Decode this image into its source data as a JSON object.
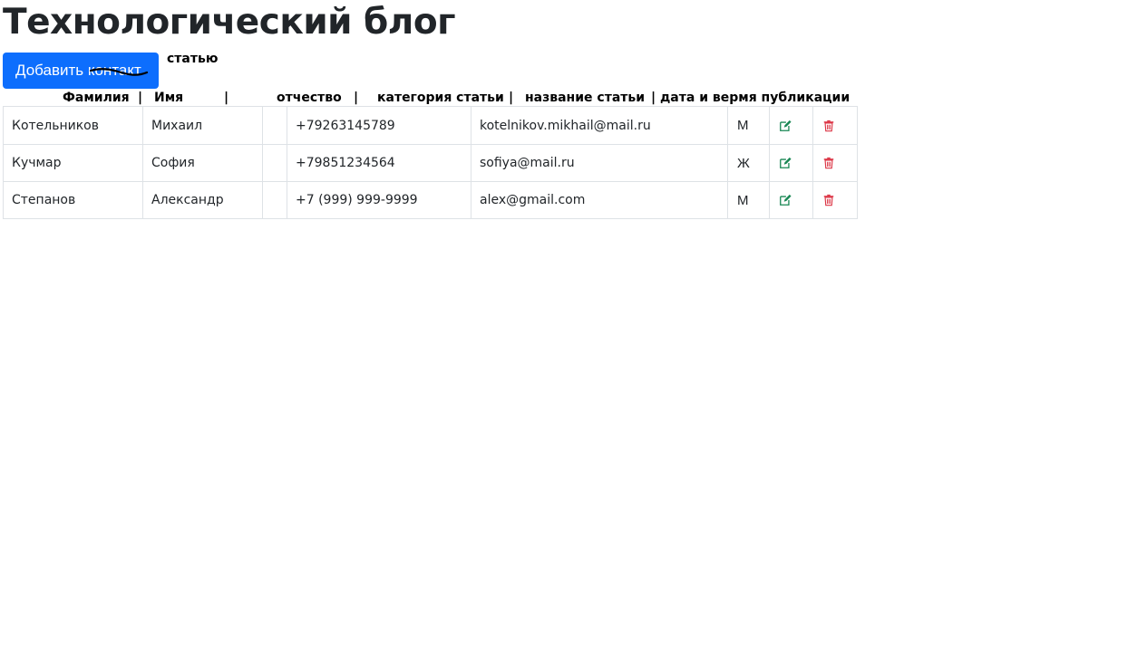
{
  "page": {
    "title": "Технологический блог",
    "add_button_label": "Добавить контакт",
    "overlay_text": "статью"
  },
  "header_labels": {
    "surname": "Фамилия",
    "name": "Имя",
    "patronymic": "отчество",
    "category": "категория статьи",
    "article_title": "название статьи",
    "datetime": "дата и вермя публикации",
    "separator": "|"
  },
  "rows": [
    {
      "surname": "Котельников",
      "name": "Михаил",
      "patronymic": "",
      "phone": "+79263145789",
      "email": "kotelnikov.mikhail@mail.ru",
      "gender": "М"
    },
    {
      "surname": "Кучмар",
      "name": "София",
      "patronymic": "",
      "phone": "+79851234564",
      "email": "sofiya@mail.ru",
      "gender": "Ж"
    },
    {
      "surname": "Степанов",
      "name": "Александр",
      "patronymic": "",
      "phone": "+7 (999) 999-9999",
      "email": "alex@gmail.com",
      "gender": "М"
    }
  ],
  "icons": {
    "edit": "edit-icon",
    "delete": "delete-icon"
  },
  "colors": {
    "primary_button": "#0d6efd",
    "edit_icon": "#198754",
    "delete_icon": "#dc3545",
    "table_border": "#dee2e6"
  }
}
